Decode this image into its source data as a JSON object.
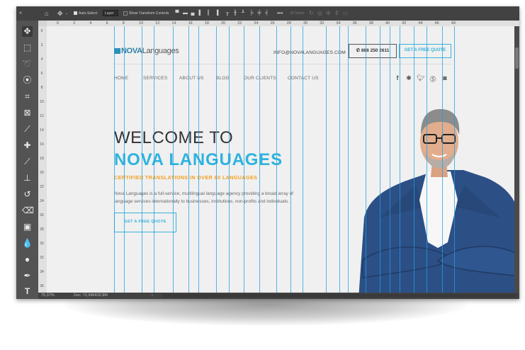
{
  "options_bar": {
    "auto_select_label": "Auto-Select:",
    "layer_select_value": "Layer",
    "transform_label": "Show Transform Controls",
    "mode_label": "3D Mode:"
  },
  "toolbar": {
    "tools": [
      "move-icon",
      "marquee-icon",
      "lasso-icon",
      "quick-select-icon",
      "crop-icon",
      "frame-icon",
      "eyedropper-icon",
      "healing-brush-icon",
      "brush-icon",
      "stamp-icon",
      "history-brush-icon",
      "eraser-icon",
      "gradient-icon",
      "blur-icon",
      "dodge-icon",
      "pen-icon",
      "type-icon"
    ]
  },
  "ruler": {
    "top_labels": [
      "0",
      "2",
      "4",
      "6",
      "8",
      "10",
      "12",
      "14",
      "16",
      "18",
      "20",
      "22",
      "24",
      "26",
      "28",
      "30",
      "32",
      "34",
      "36",
      "38",
      "40",
      "42",
      "44",
      "46",
      "48"
    ],
    "left_labels": [
      "0",
      "2",
      "4",
      "6",
      "8",
      "10",
      "12",
      "14",
      "16",
      "18",
      "20",
      "22",
      "24",
      "26",
      "28",
      "30",
      "32",
      "34",
      "36"
    ]
  },
  "status": {
    "zoom": "75,37%",
    "doc_size": "Doc: 72,6M/432,8M"
  },
  "site": {
    "logo_mark": "NOVA",
    "logo_text": "Languages",
    "email": "INFO@NOVALANGUAGES.COM",
    "phone": "888 250 2611",
    "quote_button": "GET A FREE QUOTE",
    "nav": [
      "HOME",
      "SERVICES",
      "ABOUT US",
      "BLOG",
      "OUR CLIENTS",
      "CONTACT US"
    ],
    "social": [
      "facebook-icon",
      "yelp-icon",
      "twitter-icon",
      "pinterest-icon",
      "instagram-icon"
    ],
    "headline_line1": "WELCOME TO",
    "headline_line2": "NOVA LANGUAGES",
    "subheadline": "CERTIFIED TRANSLATIONS IN OVER 80 LANGUAGES",
    "paragraph": "Nova Languages is a full-service, multilingual language agency providing a broad array of language services internationally to businesses, institutions, non-profits and individuals.",
    "cta_button": "GET A FREE QUOTE"
  },
  "colors": {
    "accent": "#36b3d9",
    "heading_accent": "#2fb3de",
    "subheading": "#f2a01f",
    "guide": "#1ea0e0",
    "suit": "#2c4f86"
  }
}
